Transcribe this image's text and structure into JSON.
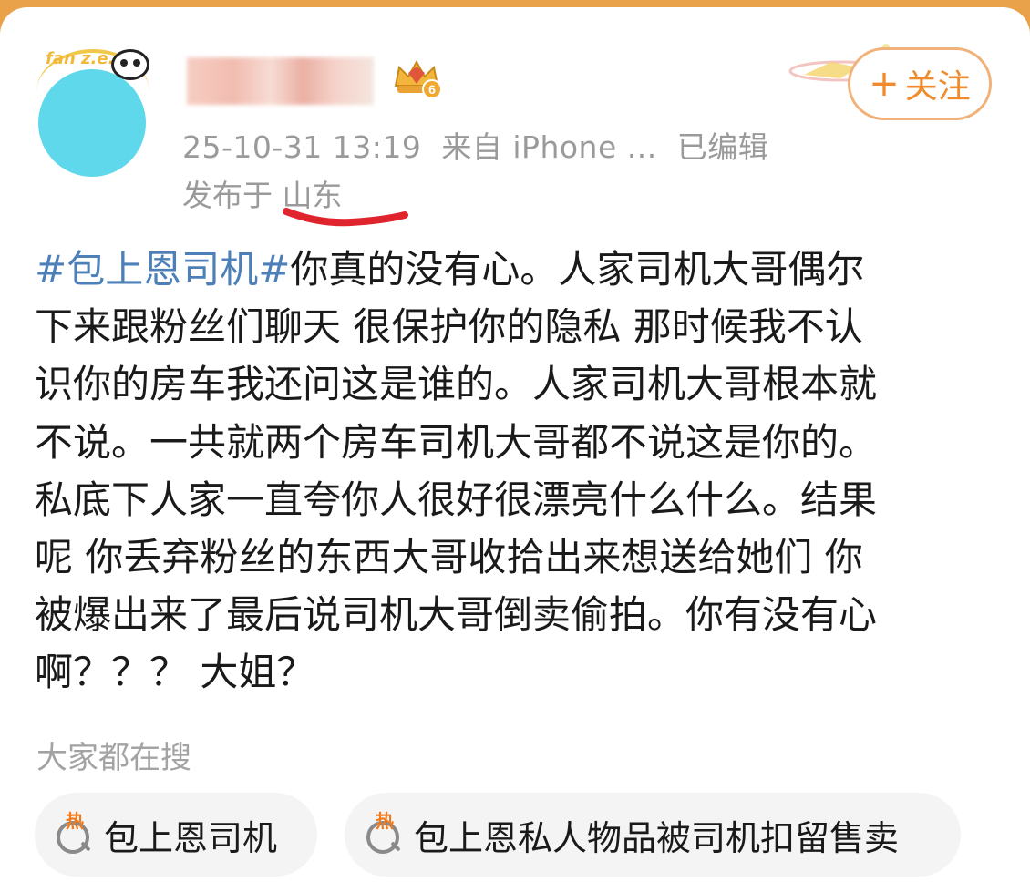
{
  "post_header": {
    "avatar_text": "fan z.e.",
    "follow_label": "关注",
    "timestamp": "25-10-31 13:19",
    "source": "来自 iPhone ...",
    "edited": "已编辑",
    "location_prefix": "发布于",
    "location": "山东",
    "badge_level": "6"
  },
  "post": {
    "hashtag": "#包上恩司机#",
    "lines": [
      "你真的没有心。人家司机大哥偶尔",
      "下来跟粉丝们聊天 很保护你的隐私 那时候我不认",
      "识你的房车我还问这是谁的。人家司机大哥根本就",
      "不说。一共就两个房车司机大哥都不说这是你的。",
      "私底下人家一直夸你人很好很漂亮什么什么。结果",
      "呢  你丢弃粉丝的东西大哥收拾出来想送给她们  你",
      "被爆出来了最后说司机大哥倒卖偷拍。你有没有心",
      "啊？？？ 大姐？"
    ]
  },
  "search_section": {
    "heading": "大家都在搜",
    "hot_badge": "热",
    "chips": [
      {
        "label": "包上恩司机"
      },
      {
        "label": "包上恩私人物品被司机扣留售卖"
      }
    ]
  },
  "colors": {
    "hashtag": "#4d7fb8",
    "follow": "#f08a2a",
    "annotation": "#e0242e"
  }
}
